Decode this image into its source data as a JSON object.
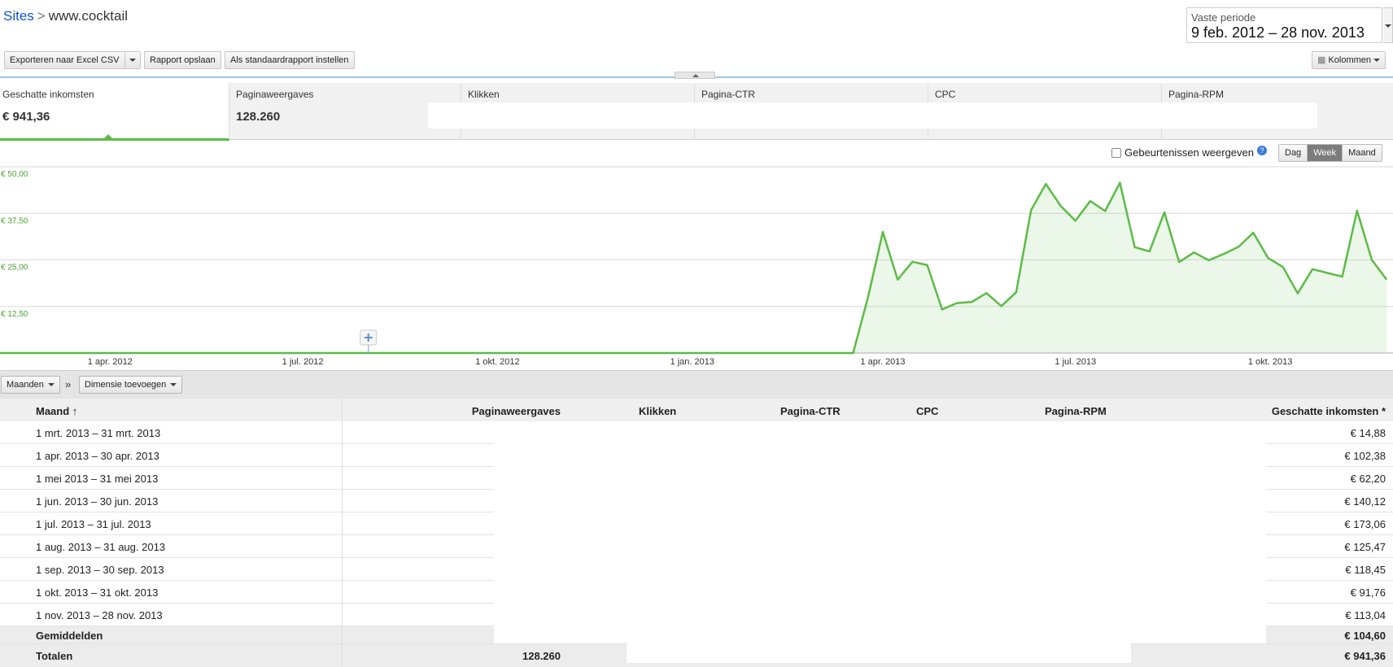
{
  "breadcrumb": {
    "link": "Sites",
    "separator": ">",
    "current": "www.cocktail"
  },
  "date_range": {
    "label": "Vaste periode",
    "value": "9 feb. 2012 – 28 nov. 2013"
  },
  "toolbar": {
    "export_label": "Exporteren naar Excel CSV",
    "save_label": "Rapport opslaan",
    "default_label": "Als standaardrapport instellen",
    "columns_label": "Kolommen"
  },
  "metrics": [
    {
      "label": "Geschatte inkomsten",
      "value": "€ 941,36"
    },
    {
      "label": "Paginaweergaves",
      "value": "128.260"
    },
    {
      "label": "Klikken",
      "value": ""
    },
    {
      "label": "Pagina-CTR",
      "value": ""
    },
    {
      "label": "CPC",
      "value": ""
    },
    {
      "label": "Pagina-RPM",
      "value": ""
    }
  ],
  "chart_controls": {
    "events_label": "Gebeurtenissen weergeven",
    "help": "?",
    "granularity": [
      "Dag",
      "Week",
      "Maand"
    ],
    "selected_granularity": "Week"
  },
  "colors": {
    "accent": "#5dbb46",
    "link": "#1155cc",
    "active_segment": "#7c7c7c"
  },
  "chart_data": {
    "type": "area",
    "x_type": "date",
    "x": [
      "2012-02-13",
      "2012-03-01",
      "2012-04-01",
      "2012-05-01",
      "2012-06-01",
      "2012-07-01",
      "2012-08-01",
      "2012-09-01",
      "2012-10-01",
      "2012-11-01",
      "2012-12-01",
      "2013-01-01",
      "2013-02-01",
      "2013-03-01",
      "2013-03-18",
      "2013-03-25",
      "2013-04-01",
      "2013-04-08",
      "2013-04-15",
      "2013-04-22",
      "2013-04-29",
      "2013-05-06",
      "2013-05-13",
      "2013-05-20",
      "2013-05-27",
      "2013-06-03",
      "2013-06-10",
      "2013-06-17",
      "2013-06-24",
      "2013-07-01",
      "2013-07-08",
      "2013-07-15",
      "2013-07-22",
      "2013-07-29",
      "2013-08-05",
      "2013-08-12",
      "2013-08-19",
      "2013-08-26",
      "2013-09-02",
      "2013-09-09",
      "2013-09-16",
      "2013-09-23",
      "2013-09-30",
      "2013-10-07",
      "2013-10-14",
      "2013-10-21",
      "2013-10-28",
      "2013-11-04",
      "2013-11-11",
      "2013-11-18",
      "2013-11-25"
    ],
    "series": [
      {
        "values": [
          0,
          0,
          0,
          0,
          0,
          0,
          0,
          0,
          0,
          0,
          0,
          0,
          0,
          0,
          0,
          14.9,
          32.5,
          19.7,
          24.5,
          23.6,
          11.7,
          13.4,
          13.7,
          16.1,
          12.6,
          16.3,
          38.3,
          45.4,
          39.5,
          35.5,
          40.8,
          38.1,
          45.7,
          28.4,
          27.3,
          37.8,
          24.4,
          27.0,
          24.9,
          26.6,
          28.5,
          32.3,
          25.5,
          23.1,
          16.0,
          22.5,
          21.5,
          20.5,
          38.2,
          25.0,
          19.7
        ]
      }
    ],
    "y_ticks": [
      "€ 12,50",
      "€ 25,00",
      "€ 37,50",
      "€ 50,00"
    ],
    "x_ticks": [
      {
        "date": "2012-04-01",
        "label": "1 apr. 2012"
      },
      {
        "date": "2012-07-01",
        "label": "1 jul. 2012"
      },
      {
        "date": "2012-10-01",
        "label": "1 okt. 2012"
      },
      {
        "date": "2013-01-01",
        "label": "1 jan. 2013"
      },
      {
        "date": "2013-04-01",
        "label": "1 apr. 2013"
      },
      {
        "date": "2013-07-01",
        "label": "1 jul. 2013"
      },
      {
        "date": "2013-10-01",
        "label": "1 okt. 2013"
      }
    ],
    "x_range": [
      "2012-02-09",
      "2013-11-28"
    ],
    "ylim": [
      0,
      50
    ],
    "grid": true,
    "annotation_marker_date": "2012-08-01"
  },
  "dimension_bar": {
    "period_label": "Maanden",
    "separator": "»",
    "add_dimension_label": "Dimensie toevoegen"
  },
  "table": {
    "columns": [
      "Maand ↑",
      "Paginaweergaves",
      "Klikken",
      "Pagina-CTR",
      "CPC",
      "Pagina-RPM",
      "Geschatte inkomsten *"
    ],
    "rows": [
      {
        "month": "1 mrt. 2013 – 31 mrt. 2013",
        "earnings": "€ 14,88"
      },
      {
        "month": "1 apr. 2013 – 30 apr. 2013",
        "earnings": "€ 102,38"
      },
      {
        "month": "1 mei 2013 – 31 mei 2013",
        "earnings": "€ 62,20"
      },
      {
        "month": "1 jun. 2013 – 30 jun. 2013",
        "earnings": "€ 140,12"
      },
      {
        "month": "1 jul. 2013 – 31 jul. 2013",
        "earnings": "€ 173,06"
      },
      {
        "month": "1 aug. 2013 – 31 aug. 2013",
        "earnings": "€ 125,47"
      },
      {
        "month": "1 sep. 2013 – 30 sep. 2013",
        "earnings": "€ 118,45"
      },
      {
        "month": "1 okt. 2013 – 31 okt. 2013",
        "earnings": "€ 91,76"
      },
      {
        "month": "1 nov. 2013 – 28 nov. 2013",
        "earnings": "€ 113,04"
      }
    ],
    "averages": {
      "label": "Gemiddelden",
      "earnings": "€ 104,60"
    },
    "totals": {
      "label": "Totalen",
      "pageviews": "128.260",
      "earnings": "€ 941,36"
    }
  }
}
